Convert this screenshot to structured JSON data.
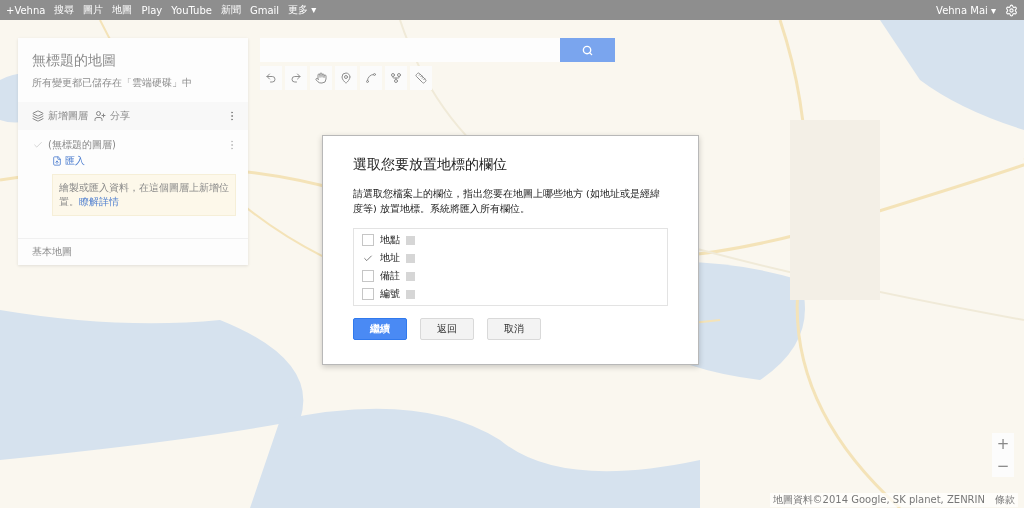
{
  "top_bar": {
    "links": [
      "+Vehna",
      "搜尋",
      "圖片",
      "地圖",
      "Play",
      "YouTube",
      "新聞",
      "Gmail",
      "更多 ▾"
    ],
    "account": "Vehna Mai ▾"
  },
  "map_panel": {
    "title": "無標題的地圖",
    "subtitle": "所有變更都已儲存在「雲端硬碟」中",
    "actions": [
      {
        "kind": "layer",
        "label": "新增圖層"
      },
      {
        "kind": "share",
        "label": "分享"
      }
    ],
    "layer": {
      "name": "(無標題的圖層)",
      "checked": true,
      "import_link": "匯入",
      "hint": "繪製或匯入資料，在這個圖層上新增位置。",
      "hint_link": "瞭解詳情"
    },
    "base_map": "基本地圖"
  },
  "dialog": {
    "title": "選取您要放置地標的欄位",
    "text": "請選取您檔案上的欄位，指出您要在地圖上哪些地方 (如地址或是經緯度等) 放置地標。系統將匯入所有欄位。",
    "fields": [
      {
        "label": "地點",
        "checked": false
      },
      {
        "label": "地址",
        "checked": true
      },
      {
        "label": "備註",
        "checked": false
      },
      {
        "label": "編號",
        "checked": false
      }
    ],
    "buttons": [
      {
        "label": "繼續",
        "kind": "primary"
      },
      {
        "label": "返回",
        "kind": "default"
      },
      {
        "label": "取消",
        "kind": "default"
      }
    ]
  },
  "zoom": {
    "in": "+",
    "out": "−"
  },
  "attribution": {
    "text": "地圖資料©2014 Google, SK planet, ZENRIN",
    "terms": "條款"
  }
}
